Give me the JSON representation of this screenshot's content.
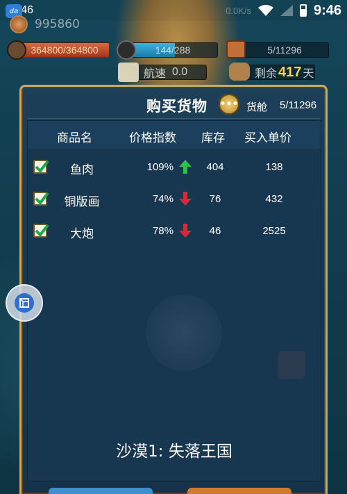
{
  "status_bar": {
    "time_left": "21:46",
    "net_speed": "0.0K/s",
    "time_right": "9:46",
    "app_badge": "da"
  },
  "hud": {
    "gold": "995860",
    "hp": "364800/364800",
    "crew": "144/288",
    "cargo": "5/11296",
    "speed_label": "航速",
    "speed_value": "0.0",
    "days_label": "剩余",
    "days_value": "417",
    "days_unit": "天"
  },
  "dialog": {
    "title": "购买货物",
    "hold_label": "货舱",
    "hold_value": "5/11296",
    "columns": [
      "商品名",
      "价格指数",
      "库存",
      "买入单价"
    ],
    "rows": [
      {
        "name": "鱼肉",
        "price_index": "109%",
        "trend": "up",
        "stock": "404",
        "price": "138",
        "checked": true
      },
      {
        "name": "铜版画",
        "price_index": "74%",
        "trend": "down",
        "stock": "76",
        "price": "432",
        "checked": true
      },
      {
        "name": "大炮",
        "price_index": "78%",
        "trend": "down",
        "stock": "46",
        "price": "2525",
        "checked": true
      }
    ],
    "location": "沙漠1: 失落王国"
  },
  "colors": {
    "frame_gold": "#c9a968",
    "panel_bg": "#173650",
    "trend_up": "#2fbf4a",
    "trend_down": "#d8283a",
    "days_highlight": "#ffd43a"
  }
}
